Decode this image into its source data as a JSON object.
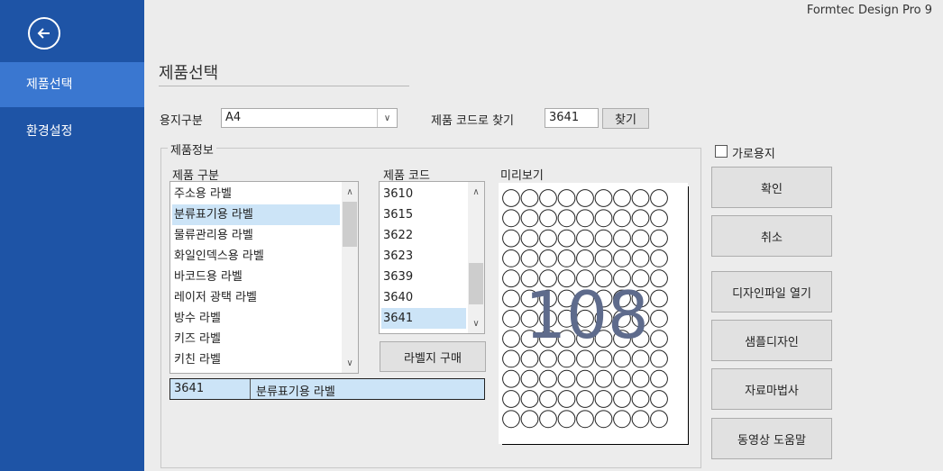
{
  "app": {
    "title": "Formtec Design Pro 9"
  },
  "sidebar": {
    "items": [
      {
        "label": "제품선택",
        "active": true
      },
      {
        "label": "환경설정",
        "active": false
      }
    ]
  },
  "page": {
    "title": "제품선택"
  },
  "filter": {
    "paper_label": "용지구분",
    "paper_value": "A4",
    "code_search_label": "제품 코드로 찾기",
    "code_search_value": "3641",
    "search_button": "찾기"
  },
  "product_info": {
    "legend": "제품정보",
    "category_header": "제품 구분",
    "code_header": "제품 코드",
    "preview_header": "미리보기",
    "categories": [
      "주소용 라벨",
      "분류표기용 라벨",
      "물류관리용 라벨",
      "화일인덱스용 라벨",
      "바코드용 라벨",
      "레이저 광택 라벨",
      "방수 라벨",
      "키즈 라벨",
      "키친 라벨"
    ],
    "selected_category": "분류표기용 라벨",
    "codes": [
      "3610",
      "3615",
      "3622",
      "3623",
      "3639",
      "3640",
      "3641"
    ],
    "selected_code": "3641",
    "buy_button": "라벨지 구매",
    "result": {
      "code": "3641",
      "category": "분류표기용 라벨"
    },
    "preview": {
      "count": "108",
      "rows": 12,
      "cols": 9
    }
  },
  "options": {
    "landscape_label": "가로용지",
    "landscape_checked": false
  },
  "actions": [
    "확인",
    "취소",
    "디자인파일 열기",
    "샘플디자인",
    "자료마법사",
    "동영상 도움말"
  ],
  "colors": {
    "sidebar": "#1e54a6",
    "sidebar_active": "#3a77d0",
    "selection": "#cce4f7",
    "preview_number": "#5e6b8c"
  }
}
